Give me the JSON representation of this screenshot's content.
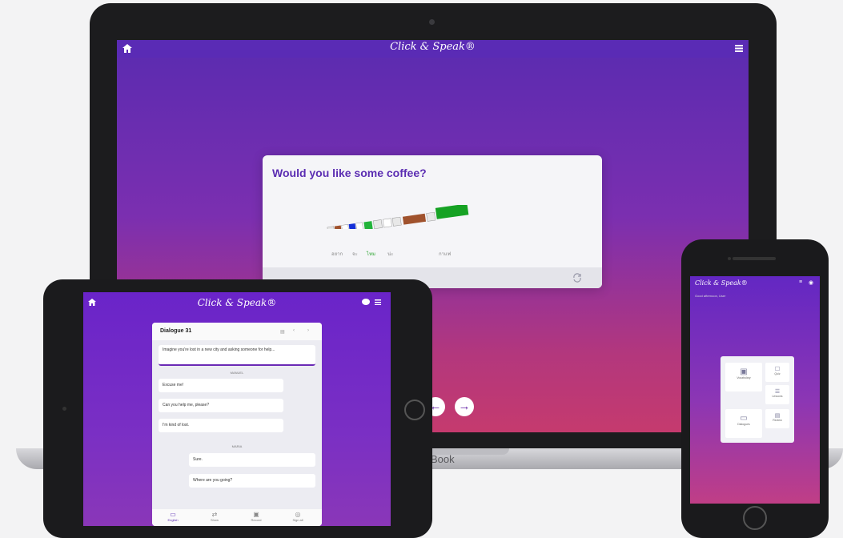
{
  "laptop": {
    "brand": "Click & Speak®",
    "home_icon": "home-icon",
    "menu_icon": "hamburger-icon",
    "card": {
      "question": "Would you like some coffee?",
      "word_hints": [
        "อยาก",
        "จะ",
        "ไหม",
        "น่ะ",
        "กาแฟ"
      ],
      "refresh_icon": "refresh-icon"
    },
    "nav": {
      "prev_icon": "arrow-left-icon",
      "next_icon": "arrow-right-icon"
    },
    "base_label": "Book"
  },
  "tablet": {
    "brand": "Click & Speak®",
    "dialogue": {
      "title": "Dialogue 31",
      "prompt": "Imagine you're lost in a new city and asking someone for help...",
      "section_1_label": "MANUEL",
      "lines_1": [
        "Excuse me!",
        "Can you help me, please?",
        "I'm kind of lost."
      ],
      "section_2_label": "MARIA",
      "lines_2": [
        "Sure.",
        "Where are you going?"
      ]
    },
    "tabs": [
      {
        "label": "English",
        "icon": "chat-icon"
      },
      {
        "label": "Show",
        "icon": "repeat-icon"
      },
      {
        "label": "Record",
        "icon": "video-icon"
      },
      {
        "label": "Sign all",
        "icon": "settings-icon"
      }
    ]
  },
  "phone": {
    "brand": "Click & Speak®",
    "subtitle": "Good afternoon, User",
    "menu": [
      {
        "label": "Vocabulary",
        "icon": "vocab-icon"
      },
      {
        "label": "Quiz",
        "icon": "quiz-icon"
      },
      {
        "label": "Lessons",
        "icon": "lessons-icon"
      },
      {
        "label": "Dialogues",
        "icon": "dialogue-icon"
      },
      {
        "label": "Review",
        "icon": "review-icon"
      }
    ]
  },
  "colors": {
    "accent": "#5b2db2",
    "gradient_top": "#5a2bb0",
    "gradient_bottom": "#c53a6e"
  }
}
